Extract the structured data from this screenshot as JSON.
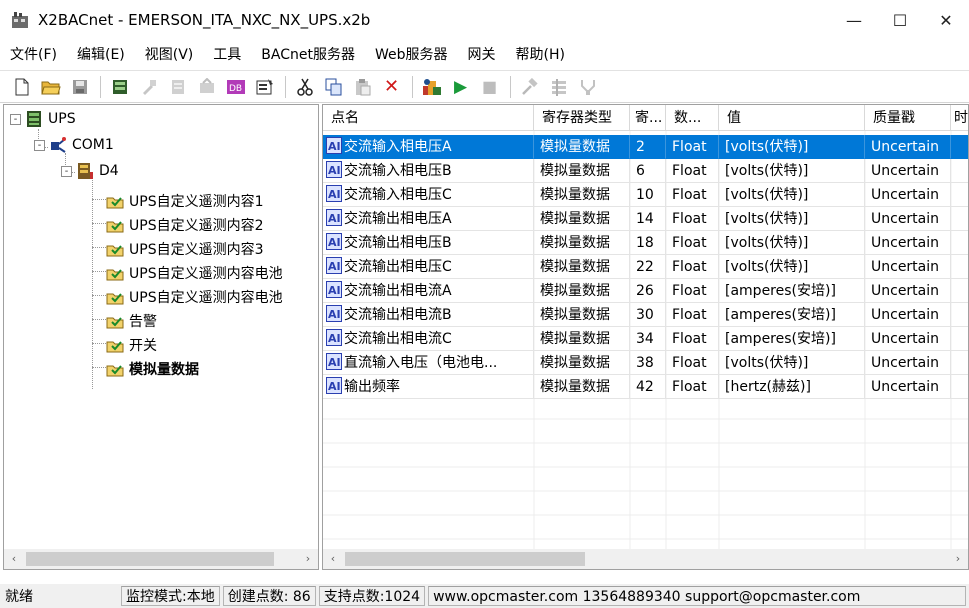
{
  "window": {
    "title": "X2BACnet - EMERSON_ITA_NXC_NX_UPS.x2b",
    "minimize": "—",
    "maximize": "☐",
    "close": "✕"
  },
  "menu": [
    "文件(F)",
    "编辑(E)",
    "视图(V)",
    "工具",
    "BACnet服务器",
    "Web服务器",
    "网关",
    "帮助(H)"
  ],
  "toolbar": {
    "icons": [
      "new-file-icon",
      "open-folder-icon",
      "save-icon",
      "add-device-icon",
      "tool-disabled-icon",
      "tool-disabled-icon",
      "tool-disabled-icon",
      "db-icon",
      "properties-icon",
      "cut-icon",
      "copy-icon",
      "paste-icon",
      "delete-icon",
      "monitor-icon",
      "run-icon",
      "stop-icon",
      "hammer-icon",
      "tool2-icon",
      "tool3-icon"
    ],
    "delete_glyph": "✕",
    "run_glyph": "▶",
    "stop_glyph": "■"
  },
  "tree": {
    "root": "UPS",
    "port": "COM1",
    "device": "D4",
    "groups": [
      "UPS自定义遥测内容1",
      "UPS自定义遥测内容2",
      "UPS自定义遥测内容3",
      "UPS自定义遥测内容电池",
      "UPS自定义遥测内容电池",
      "告警",
      "开关",
      "模拟量数据"
    ],
    "expand_glyph": "-"
  },
  "table": {
    "columns": [
      "点名",
      "寄存器类型",
      "寄...",
      "数...",
      "值",
      "质量戳",
      "时"
    ],
    "rows": [
      {
        "name": "交流输入相电压A",
        "type": "模拟量数据",
        "reg": "2",
        "dtype": "Float",
        "value": "[volts(伏特)]",
        "quality": "Uncertain",
        "selected": true
      },
      {
        "name": "交流输入相电压B",
        "type": "模拟量数据",
        "reg": "6",
        "dtype": "Float",
        "value": "[volts(伏特)]",
        "quality": "Uncertain"
      },
      {
        "name": "交流输入相电压C",
        "type": "模拟量数据",
        "reg": "10",
        "dtype": "Float",
        "value": "[volts(伏特)]",
        "quality": "Uncertain"
      },
      {
        "name": "交流输出相电压A",
        "type": "模拟量数据",
        "reg": "14",
        "dtype": "Float",
        "value": "[volts(伏特)]",
        "quality": "Uncertain"
      },
      {
        "name": "交流输出相电压B",
        "type": "模拟量数据",
        "reg": "18",
        "dtype": "Float",
        "value": "[volts(伏特)]",
        "quality": "Uncertain"
      },
      {
        "name": "交流输出相电压C",
        "type": "模拟量数据",
        "reg": "22",
        "dtype": "Float",
        "value": "[volts(伏特)]",
        "quality": "Uncertain"
      },
      {
        "name": "交流输出相电流A",
        "type": "模拟量数据",
        "reg": "26",
        "dtype": "Float",
        "value": "[amperes(安培)]",
        "quality": "Uncertain"
      },
      {
        "name": "交流输出相电流B",
        "type": "模拟量数据",
        "reg": "30",
        "dtype": "Float",
        "value": "[amperes(安培)]",
        "quality": "Uncertain"
      },
      {
        "name": "交流输出相电流C",
        "type": "模拟量数据",
        "reg": "34",
        "dtype": "Float",
        "value": "[amperes(安培)]",
        "quality": "Uncertain"
      },
      {
        "name": "直流输入电压（电池电...",
        "type": "模拟量数据",
        "reg": "38",
        "dtype": "Float",
        "value": "[volts(伏特)]",
        "quality": "Uncertain"
      },
      {
        "name": "输出频率",
        "type": "模拟量数据",
        "reg": "42",
        "dtype": "Float",
        "value": "[hertz(赫兹)]",
        "quality": "Uncertain"
      }
    ]
  },
  "scroll": {
    "left": "‹",
    "right": "›"
  },
  "status": {
    "ready": "就绪",
    "mode": "监控模式:本地",
    "created": "创建点数:  86",
    "supported": "支持点数:1024",
    "contact": "www.opcmaster.com 13564889340 support@opcmaster.com"
  },
  "colors": {
    "selection": "#0078d7",
    "run": "#1a9a3a",
    "delete": "#d01818"
  }
}
